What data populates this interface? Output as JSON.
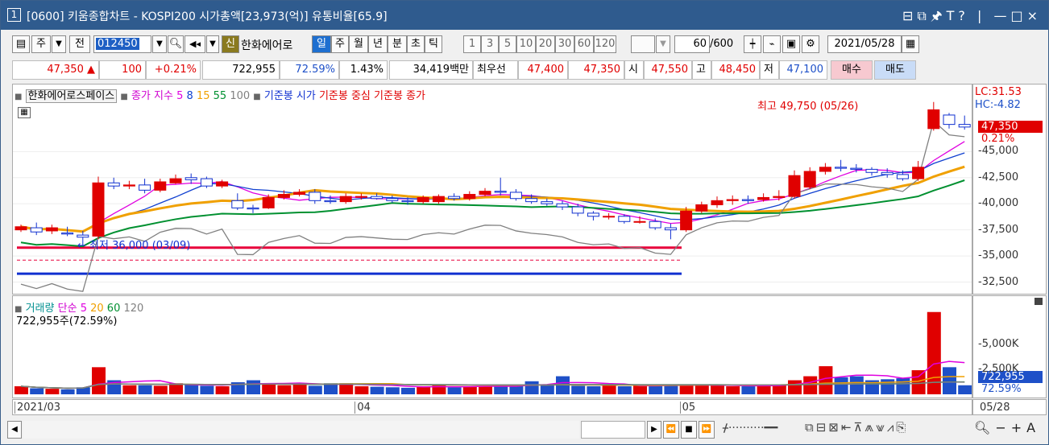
{
  "title": {
    "window_number": "1",
    "text": "[0600] 키움종합차트 - KOSPI200 시가총액[23,973(억)] 유통비율[65.9]",
    "right_icons": "⊟⧉🖈T? | —□×"
  },
  "toolbar": {
    "jong": "주",
    "jeon": "전",
    "code": "012450",
    "sin_badge": "신",
    "stock_name": "한화에어로",
    "periods": [
      "일",
      "주",
      "월",
      "년",
      "분",
      "초",
      "틱"
    ],
    "active_period": "일",
    "intervals": [
      "1",
      "3",
      "5",
      "10",
      "20",
      "30",
      "60",
      "120"
    ],
    "count": "60",
    "total": "/600",
    "date": "2021/05/28"
  },
  "info": {
    "price": "47,350",
    "change_arrow": "▲",
    "change": "100",
    "change_pct": "+0.21%",
    "volume": "722,955",
    "turnover_pct": "72.59%",
    "ratio": "1.43%",
    "amount": "34,419백만",
    "best_ask_label": "최우선",
    "best_ask": "47,400",
    "best_bid": "47,350",
    "open_label": "시",
    "open": "47,550",
    "high_label": "고",
    "high": "48,450",
    "low_label": "저",
    "low": "47,100",
    "buy_label": "매수",
    "sell_label": "매도"
  },
  "chart_legend": {
    "name": "한화에어로스페이스",
    "close_label": "종가",
    "ma_label": "지수",
    "ma_periods": [
      "5",
      "8",
      "15",
      "55",
      "100"
    ],
    "ma_colors": [
      "#e000e0",
      "#1040d0",
      "#f0a000",
      "#009030",
      "#808080"
    ],
    "base_open": "기준봉 시가",
    "base_mid": "기준봉 중심",
    "base_close": "기준봉 종가"
  },
  "annotations": {
    "high": "최고 49,750 (05/26)",
    "low": "최저 36,000 (03/09)"
  },
  "right_labels": {
    "lc": "LC:31.53",
    "hc": "HC:-4.82",
    "price_tag": "47,350",
    "price_pct": "0.21%",
    "vol_tag": "722,955",
    "vol_pct": "72.59%"
  },
  "price_ticks": [
    "45,000",
    "42,500",
    "40,000",
    "37,500",
    "35,000",
    "32,500"
  ],
  "vol_legend": {
    "title": "거래량",
    "simple": "단순",
    "periods": [
      "5",
      "20",
      "60",
      "120"
    ],
    "colors": [
      "#e000e0",
      "#f0a000",
      "#009030",
      "#808080"
    ],
    "current": "722,955주(72.59%)"
  },
  "vol_ticks": [
    "5,000K",
    "2,500K"
  ],
  "date_ticks": [
    "2021/03",
    "04",
    "05"
  ],
  "last_date": "05/28",
  "chart_data": {
    "type": "candlestick",
    "x": [
      "03/02",
      "03/03",
      "03/04",
      "03/05",
      "03/08",
      "03/09",
      "03/10",
      "03/11",
      "03/12",
      "03/15",
      "03/16",
      "03/17",
      "03/18",
      "03/19",
      "03/22",
      "03/23",
      "03/24",
      "03/25",
      "03/26",
      "03/29",
      "03/30",
      "03/31",
      "04/01",
      "04/02",
      "04/05",
      "04/06",
      "04/07",
      "04/08",
      "04/09",
      "04/12",
      "04/13",
      "04/14",
      "04/15",
      "04/16",
      "04/19",
      "04/20",
      "04/21",
      "04/22",
      "04/23",
      "04/26",
      "04/27",
      "04/28",
      "04/29",
      "04/30",
      "05/03",
      "05/04",
      "05/06",
      "05/07",
      "05/10",
      "05/11",
      "05/12",
      "05/13",
      "05/14",
      "05/17",
      "05/18",
      "05/20",
      "05/21",
      "05/24",
      "05/25",
      "05/26",
      "05/27",
      "05/28"
    ],
    "open": [
      37500,
      37700,
      37400,
      37200,
      37000,
      36900,
      42000,
      41700,
      41800,
      41300,
      42000,
      42500,
      42400,
      41700,
      40300,
      39600,
      39600,
      40600,
      40900,
      41100,
      40300,
      40200,
      40700,
      40700,
      40500,
      40300,
      40200,
      40200,
      40700,
      40500,
      40900,
      41200,
      41100,
      40500,
      40200,
      40000,
      39700,
      39100,
      38800,
      38800,
      38300,
      38300,
      37700,
      37500,
      39300,
      39900,
      40300,
      40400,
      40400,
      40600,
      40700,
      41600,
      43100,
      43500,
      43400,
      43300,
      43000,
      42800,
      42400,
      47200,
      48500,
      47600
    ],
    "close": [
      37800,
      37300,
      37700,
      37100,
      36800,
      42000,
      41700,
      41800,
      41300,
      42100,
      42400,
      42300,
      41700,
      42100,
      39600,
      39500,
      40600,
      40900,
      41100,
      40300,
      40200,
      40700,
      40700,
      40500,
      40300,
      40200,
      40600,
      40700,
      40500,
      40900,
      41200,
      41100,
      40500,
      40200,
      40000,
      39700,
      39100,
      38800,
      38800,
      38300,
      38300,
      37700,
      37500,
      39300,
      39900,
      40300,
      40400,
      40300,
      40600,
      40700,
      42700,
      43100,
      43500,
      43400,
      43300,
      43000,
      42800,
      42400,
      43500,
      49000,
      47600,
      47350
    ],
    "high": [
      38000,
      38200,
      38000,
      37800,
      37400,
      42600,
      42500,
      42200,
      42400,
      42400,
      42800,
      42900,
      42600,
      42300,
      41000,
      39900,
      40900,
      41300,
      41400,
      41400,
      40800,
      41000,
      41000,
      41000,
      40800,
      40600,
      40800,
      40900,
      41000,
      41200,
      41500,
      42500,
      41400,
      40900,
      40500,
      40300,
      40000,
      39300,
      39100,
      39000,
      38800,
      38600,
      38100,
      39700,
      40200,
      40700,
      40800,
      40800,
      41000,
      41300,
      43200,
      43500,
      43900,
      44200,
      43800,
      43500,
      43400,
      43200,
      44100,
      49750,
      48700,
      48450
    ],
    "low": [
      37300,
      37000,
      37100,
      36900,
      36000,
      36600,
      41400,
      41400,
      41000,
      41100,
      41900,
      41900,
      41500,
      41500,
      39400,
      39100,
      39500,
      40400,
      40700,
      40000,
      40000,
      40000,
      40400,
      40400,
      40100,
      39900,
      40000,
      40000,
      40300,
      40300,
      40700,
      40800,
      40300,
      40000,
      39800,
      39400,
      38800,
      38400,
      38500,
      38100,
      38100,
      37500,
      36600,
      37300,
      39100,
      39600,
      39900,
      40000,
      40200,
      40300,
      40500,
      41400,
      42800,
      43100,
      43000,
      42700,
      42500,
      42200,
      42200,
      47000,
      47200,
      47100
    ],
    "volume": [
      800,
      600,
      550,
      500,
      700,
      2700,
      1400,
      900,
      900,
      850,
      1100,
      950,
      850,
      800,
      1200,
      1400,
      1100,
      900,
      1000,
      850,
      1100,
      1100,
      800,
      750,
      700,
      650,
      800,
      900,
      700,
      750,
      850,
      800,
      900,
      1300,
      1000,
      1800,
      850,
      800,
      900,
      800,
      900,
      850,
      1000,
      900,
      900,
      850,
      800,
      800,
      900,
      1000,
      1400,
      1800,
      2800,
      1700,
      1800,
      1400,
      1500,
      1600,
      2400,
      8200,
      2700,
      900
    ],
    "ylim": [
      32000,
      50500
    ],
    "vol_ylim": [
      0,
      8500
    ]
  }
}
